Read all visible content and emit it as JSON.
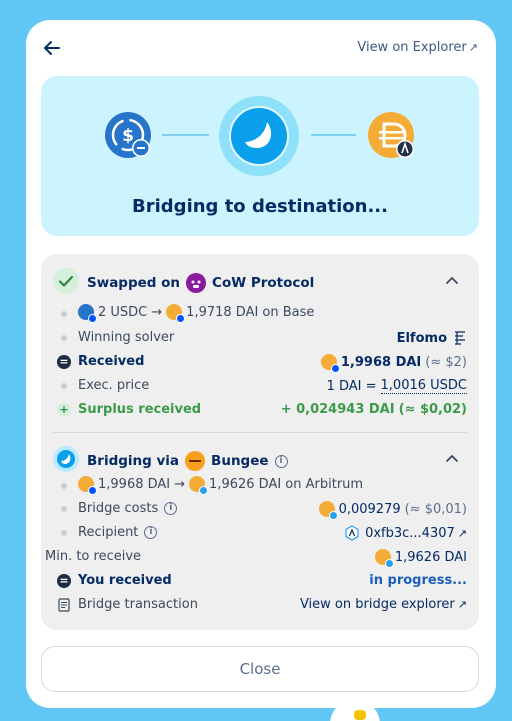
{
  "header": {
    "explorer_link": "View on Explorer",
    "explorer_arrow": "↗"
  },
  "hero": {
    "title": "Bridging to destination...",
    "source_token_icon": "usdc-token-icon",
    "destination_token_icon": "dai-token-icon",
    "progress_icon": "bridge-progress-icon"
  },
  "swap_section": {
    "title_prefix": "Swapped on",
    "provider": "CoW Protocol",
    "trade_from": "2 USDC",
    "trade_arrow": "→",
    "trade_to": "1,9718 DAI on Base",
    "winning_solver_label": "Winning solver",
    "winning_solver_value": "Elfomo",
    "received_label": "Received",
    "received_value": "1,9968 DAI",
    "received_fiat": "(≈ $2)",
    "exec_price_label": "Exec. price",
    "exec_price_prefix": "1 DAI =",
    "exec_price_value": "1,0016 USDC",
    "surplus_label": "Surplus received",
    "surplus_value": "+ 0,024943 DAI",
    "surplus_fiat": "(≈ $0,02)"
  },
  "bridge_section": {
    "title_prefix": "Bridging via",
    "provider": "Bungee",
    "trade_from": "1,9968 DAI",
    "trade_arrow": "→",
    "trade_to": "1,9626 DAI on Arbitrum",
    "bridge_costs_label": "Bridge costs",
    "bridge_costs_value": "0,009279",
    "bridge_costs_fiat": "(≈ $0,01)",
    "recipient_label": "Recipient",
    "recipient_value": "0xfb3c...4307",
    "min_receive_label": "Min. to receive",
    "min_receive_value": "1,9626 DAI",
    "you_received_label": "You received",
    "you_received_value": "in progress...",
    "bridge_tx_label": "Bridge transaction",
    "bridge_tx_link": "View on bridge explorer"
  },
  "footer": {
    "close_label": "Close"
  },
  "colors": {
    "background": "#62c7f5",
    "hero_bg": "#ccf4ff",
    "primary_text": "#052b65",
    "success_green": "#3b9b4a",
    "link_blue": "#1c5fb8",
    "usdc_blue": "#2775ca",
    "dai_yellow": "#f5ac37"
  }
}
